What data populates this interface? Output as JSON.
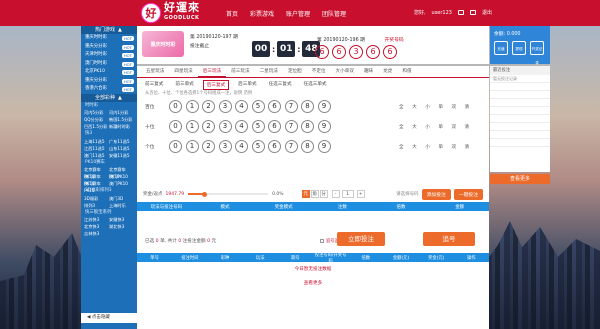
{
  "brand": {
    "seal": "好",
    "name": "好運來",
    "sub": "GOODLUCK"
  },
  "nav": [
    "首页",
    "彩票游戏",
    "账户管理",
    "团队管理"
  ],
  "user": {
    "greeting": "您好,",
    "name": "user123",
    "logout": "退出"
  },
  "sidebar": {
    "section1_title": "热门游戏",
    "hot": [
      {
        "label": "重庆时时彩",
        "tag": "HOT"
      },
      {
        "label": "重庆分分彩",
        "tag": "HOT"
      },
      {
        "label": "天津时时彩",
        "tag": "HOT"
      },
      {
        "label": "澳门时时彩",
        "tag": "HOT"
      },
      {
        "label": "北京PK10",
        "tag": "HOT"
      },
      {
        "label": "重庆分分彩",
        "tag": "HOT"
      },
      {
        "label": "香港六合彩",
        "tag": "HOT"
      }
    ],
    "section2_title": "全部彩种",
    "ssc_title": "时时彩",
    "ssc": [
      "河内5分彩",
      "河内1分彩",
      "QQ分分彩",
      "韩国1.5分彩",
      "巴西1.5分彩",
      "新疆时时彩"
    ],
    "k3_title": "快3",
    "k3": [
      "上海11选5",
      "广东11选5",
      "江西11选5",
      "山东11选5",
      "澳门11选5",
      "安徽11选5"
    ],
    "pk_title": "PK10赛车",
    "pk": [
      "北京赛车PK10",
      "北京赛车PK10",
      "澳门赛车PK10",
      "澳门PK10",
      "澳门赛车PK10",
      "澳门PK10"
    ],
    "d3_title": "3D福彩排列3",
    "d3": [
      "3D福彩",
      "澳门3D",
      "排列3",
      "上海时乐"
    ],
    "k3b_title": "快三骰宝系列",
    "k3b": [
      "江苏快3",
      "安徽快3",
      "北京快3",
      "湖北快3",
      "吉林快3"
    ],
    "footer": "点击隐藏"
  },
  "header": {
    "lottery_name": "重庆时时彩",
    "issue_line1": "第 20190120-197 期",
    "issue_line2": "投注截止",
    "timer": [
      "00",
      "01",
      "48"
    ],
    "issue_result": "第 20190120-196 期",
    "result_pill": "开奖号码",
    "result": [
      "6",
      "6",
      "3",
      "6",
      "6"
    ]
  },
  "tabs1": [
    "五星玩法",
    "四星玩法",
    "后三玩法",
    "前三玩法",
    "二星玩法",
    "定位胆",
    "不定位",
    "大小单双",
    "趣味",
    "龙虎",
    "和值"
  ],
  "tabs1_active": 2,
  "tabs2": [
    "前三复式",
    "前三单式",
    "后三复式",
    "后三单式",
    "任选三复式",
    "任选三单式"
  ],
  "tabs2_active": 2,
  "hint": "从百位、十位、个位各选择1个号码组成一注，说明  范例",
  "rows": [
    {
      "label": "百位",
      "balls": [
        "0",
        "1",
        "2",
        "3",
        "4",
        "5",
        "6",
        "7",
        "8",
        "9"
      ]
    },
    {
      "label": "十位",
      "balls": [
        "0",
        "1",
        "2",
        "3",
        "4",
        "5",
        "6",
        "7",
        "8",
        "9"
      ]
    },
    {
      "label": "个位",
      "balls": [
        "0",
        "1",
        "2",
        "3",
        "4",
        "5",
        "6",
        "7",
        "8",
        "9"
      ]
    }
  ],
  "ops": [
    "全",
    "大",
    "小",
    "单",
    "双",
    "清"
  ],
  "bet": {
    "rebate_label": "奖金/返点",
    "rebate_value": "1947.79",
    "rebate_pct": "0.0%",
    "rebate_fill": 0.2,
    "units": [
      "元",
      "角",
      "分"
    ],
    "multiplier": "1",
    "confirm": "添加投注",
    "quick": "一键投注",
    "select_hint": "请选择号码"
  },
  "table_head": [
    "玩法与投注号码",
    "模式",
    "奖金模式",
    "注数",
    "倍数",
    "金额"
  ],
  "summary": {
    "text1": "已选",
    "count": "0",
    "text2": "单, 共计",
    "bets": "0",
    "text3": "注投注金额",
    "amount": "0",
    "text4": "元"
  },
  "stop_label": "追号追停",
  "buy_now": "立即投注",
  "chase": "追号",
  "history_head": [
    "单号",
    "投注时间",
    "彩种",
    "玩法",
    "期号",
    "投注号码/开奖号码",
    "倍数",
    "金额(元)",
    "奖金(元)",
    "操作"
  ],
  "history_empty": "今日暂无投注数据",
  "history_more": "查看更多",
  "right": {
    "balance_label": "余额:",
    "balance": "0.000",
    "icons": [
      "充值",
      "提现",
      "开奖记录"
    ],
    "panel_title": "最近投注",
    "rows": [
      "暂无投注记录",
      "",
      "",
      "",
      "",
      "",
      "",
      "",
      ""
    ],
    "btn": "查看更多"
  }
}
